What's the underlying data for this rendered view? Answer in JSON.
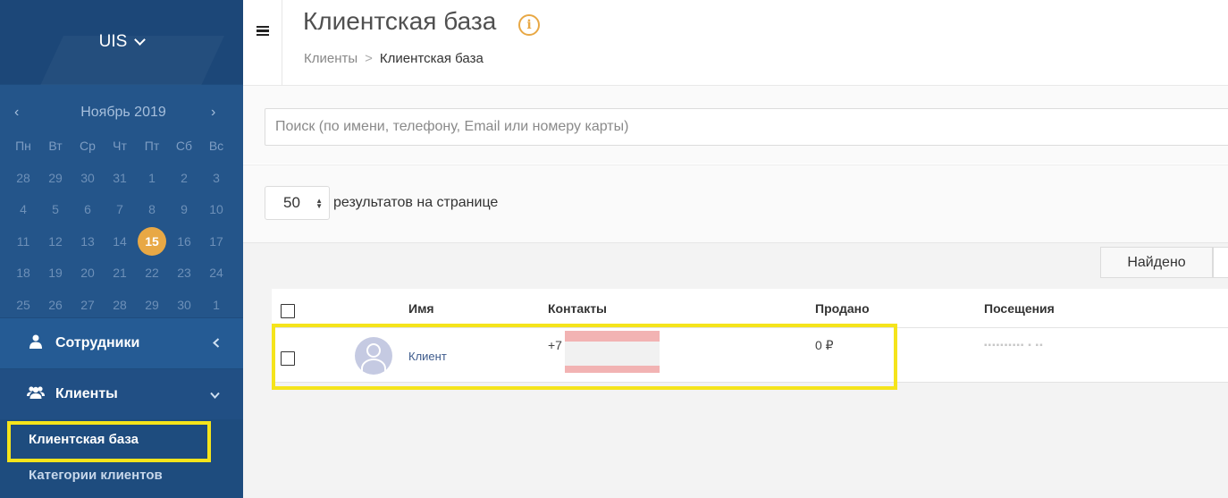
{
  "sidebar": {
    "brand": "UIS",
    "calendar": {
      "month_label": "Ноябрь 2019",
      "prev_icon": "‹",
      "next_icon": "›",
      "weekdays": [
        "Пн",
        "Вт",
        "Ср",
        "Чт",
        "Пт",
        "Сб",
        "Вс"
      ],
      "weeks": [
        [
          "28",
          "29",
          "30",
          "31",
          "1",
          "2",
          "3"
        ],
        [
          "4",
          "5",
          "6",
          "7",
          "8",
          "9",
          "10"
        ],
        [
          "11",
          "12",
          "13",
          "14",
          "15",
          "16",
          "17"
        ],
        [
          "18",
          "19",
          "20",
          "21",
          "22",
          "23",
          "24"
        ],
        [
          "25",
          "26",
          "27",
          "28",
          "29",
          "30",
          "1"
        ]
      ],
      "today": "15",
      "today_color": "#e8a845"
    },
    "nav": {
      "staff_label": "Сотрудники",
      "clients_label": "Клиенты",
      "sub": {
        "client_base": "Клиентская база",
        "client_categories": "Категории клиентов"
      }
    },
    "highlight_color": "#f5e41b"
  },
  "header": {
    "title": "Клиентская база",
    "info_icon": "i",
    "breadcrumb": {
      "parent": "Клиенты",
      "separator": ">",
      "current": "Клиентская база"
    }
  },
  "search": {
    "placeholder": "Поиск (по имени, телефону, Email или номеру карты)",
    "value": ""
  },
  "paging": {
    "per_page_value": "50",
    "per_page_label": "результатов на странице",
    "found_button": "Найдено"
  },
  "table": {
    "columns": {
      "name": "Имя",
      "contacts": "Контакты",
      "sold": "Продано",
      "visits": "Посещения"
    },
    "rows": [
      {
        "name": "Клиент",
        "phone_prefix": "+7",
        "sold": "0 ₽",
        "visits": "▪▪▪▪▪▪▪▪▪▪ ▪ ▪▪"
      }
    ]
  }
}
